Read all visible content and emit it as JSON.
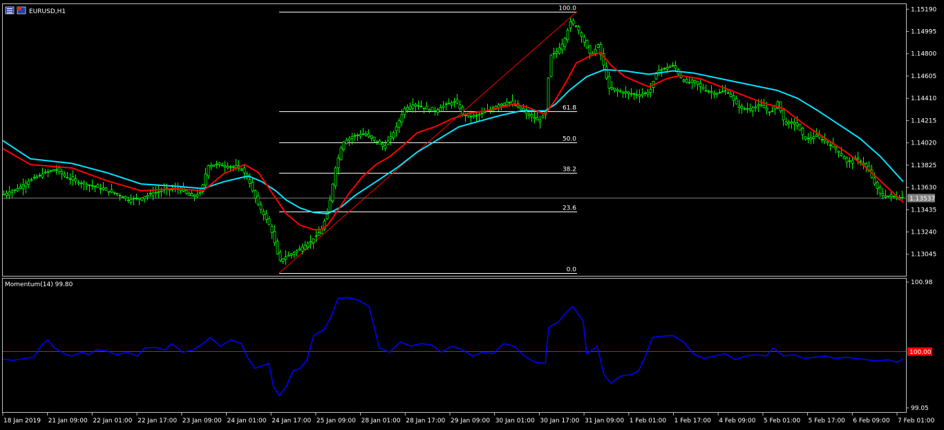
{
  "window": {
    "symbol_label": "EURUSD,H1",
    "indicator_label": "Momentum(14) 99.80"
  },
  "colors": {
    "background": "#000000",
    "frame": "#c0c0c0",
    "bull_candle": "#00ff00",
    "fast_ma": "#ff0000",
    "slow_ma": "#00e5ff",
    "fib": "#ffffff",
    "trendline": "#ff0000",
    "momentum": "#0000ff",
    "momentum_level": "#ff0000",
    "price_tag": "#808080",
    "level_tag": "#ff0000"
  },
  "chart_data": [
    {
      "type": "candlestick",
      "title": "EURUSD,H1",
      "y_ticks": [
        "1.15190",
        "1.14995",
        "1.14800",
        "1.14605",
        "1.14410",
        "1.14215",
        "1.14020",
        "1.13825",
        "1.13630",
        "1.13435",
        "1.13240",
        "1.13045"
      ],
      "ylim": [
        1.1288,
        1.1521
      ],
      "current_price": "1.13537",
      "x_ticks": [
        "18 Jan 2019",
        "21 Jan 09:00",
        "22 Jan 01:00",
        "22 Jan 17:00",
        "23 Jan 09:00",
        "24 Jan 01:00",
        "24 Jan 17:00",
        "25 Jan 09:00",
        "28 Jan 01:00",
        "28 Jan 17:00",
        "29 Jan 09:00",
        "30 Jan 01:00",
        "30 Jan 17:00",
        "31 Jan 09:00",
        "1 Feb 01:00",
        "1 Feb 17:00",
        "4 Feb 09:00",
        "5 Feb 01:00",
        "5 Feb 17:00",
        "6 Feb 09:00",
        "7 Feb 01:00"
      ],
      "close_path": [
        [
          0,
          1.1357
        ],
        [
          20,
          1.1362
        ],
        [
          40,
          1.137
        ],
        [
          60,
          1.1376
        ],
        [
          75,
          1.1379
        ],
        [
          90,
          1.1372
        ],
        [
          110,
          1.1367
        ],
        [
          130,
          1.1364
        ],
        [
          150,
          1.136
        ],
        [
          165,
          1.1357
        ],
        [
          180,
          1.1352
        ],
        [
          200,
          1.1354
        ],
        [
          215,
          1.1358
        ],
        [
          235,
          1.1361
        ],
        [
          255,
          1.1362
        ],
        [
          270,
          1.1355
        ],
        [
          285,
          1.1358
        ],
        [
          295,
          1.1382
        ],
        [
          310,
          1.1383
        ],
        [
          330,
          1.1381
        ],
        [
          345,
          1.1379
        ],
        [
          355,
          1.1368
        ],
        [
          365,
          1.1352
        ],
        [
          375,
          1.134
        ],
        [
          383,
          1.1332
        ],
        [
          390,
          1.132
        ],
        [
          395,
          1.1306
        ],
        [
          400,
          1.1299
        ],
        [
          410,
          1.1303
        ],
        [
          420,
          1.1306
        ],
        [
          430,
          1.131
        ],
        [
          445,
          1.1316
        ],
        [
          460,
          1.1326
        ],
        [
          470,
          1.1345
        ],
        [
          480,
          1.138
        ],
        [
          490,
          1.1402
        ],
        [
          505,
          1.1408
        ],
        [
          520,
          1.141
        ],
        [
          535,
          1.1405
        ],
        [
          550,
          1.1398
        ],
        [
          565,
          1.1412
        ],
        [
          580,
          1.1432
        ],
        [
          595,
          1.1436
        ],
        [
          610,
          1.1432
        ],
        [
          625,
          1.143
        ],
        [
          640,
          1.1436
        ],
        [
          655,
          1.1438
        ],
        [
          665,
          1.1426
        ],
        [
          680,
          1.1425
        ],
        [
          700,
          1.143
        ],
        [
          715,
          1.1435
        ],
        [
          730,
          1.1438
        ],
        [
          745,
          1.1433
        ],
        [
          760,
          1.1426
        ],
        [
          775,
          1.1421
        ],
        [
          785,
          1.143
        ],
        [
          790,
          1.1478
        ],
        [
          800,
          1.1482
        ],
        [
          810,
          1.149
        ],
        [
          820,
          1.1508
        ],
        [
          830,
          1.1503
        ],
        [
          840,
          1.149
        ],
        [
          850,
          1.1478
        ],
        [
          860,
          1.1488
        ],
        [
          868,
          1.147
        ],
        [
          875,
          1.145
        ],
        [
          890,
          1.1447
        ],
        [
          905,
          1.1445
        ],
        [
          920,
          1.1444
        ],
        [
          935,
          1.1447
        ],
        [
          945,
          1.1465
        ],
        [
          960,
          1.1468
        ],
        [
          970,
          1.147
        ],
        [
          975,
          1.1463
        ],
        [
          985,
          1.1455
        ],
        [
          1000,
          1.1455
        ],
        [
          1015,
          1.1448
        ],
        [
          1030,
          1.1445
        ],
        [
          1045,
          1.1448
        ],
        [
          1055,
          1.144
        ],
        [
          1065,
          1.1432
        ],
        [
          1080,
          1.1432
        ],
        [
          1095,
          1.1435
        ],
        [
          1110,
          1.1428
        ],
        [
          1120,
          1.1438
        ],
        [
          1130,
          1.1418
        ],
        [
          1145,
          1.142
        ],
        [
          1160,
          1.1405
        ],
        [
          1175,
          1.1408
        ],
        [
          1190,
          1.1403
        ],
        [
          1205,
          1.1396
        ],
        [
          1220,
          1.1385
        ],
        [
          1235,
          1.1388
        ],
        [
          1250,
          1.138
        ],
        [
          1260,
          1.1366
        ],
        [
          1270,
          1.1356
        ],
        [
          1285,
          1.1355
        ],
        [
          1300,
          1.1354
        ]
      ],
      "fast_ma": [
        [
          0,
          1.1397
        ],
        [
          40,
          1.1383
        ],
        [
          100,
          1.138
        ],
        [
          150,
          1.1369
        ],
        [
          200,
          1.136
        ],
        [
          250,
          1.1362
        ],
        [
          290,
          1.136
        ],
        [
          320,
          1.1375
        ],
        [
          350,
          1.1383
        ],
        [
          370,
          1.1376
        ],
        [
          390,
          1.1358
        ],
        [
          410,
          1.134
        ],
        [
          430,
          1.133
        ],
        [
          450,
          1.1326
        ],
        [
          460,
          1.1326
        ],
        [
          470,
          1.133
        ],
        [
          485,
          1.1343
        ],
        [
          500,
          1.1357
        ],
        [
          520,
          1.1372
        ],
        [
          540,
          1.1383
        ],
        [
          560,
          1.139
        ],
        [
          580,
          1.14
        ],
        [
          600,
          1.1411
        ],
        [
          625,
          1.1416
        ],
        [
          650,
          1.1423
        ],
        [
          675,
          1.1428
        ],
        [
          700,
          1.143
        ],
        [
          740,
          1.1436
        ],
        [
          760,
          1.1433
        ],
        [
          785,
          1.1427
        ],
        [
          800,
          1.144
        ],
        [
          815,
          1.1455
        ],
        [
          830,
          1.1472
        ],
        [
          850,
          1.1478
        ],
        [
          865,
          1.1481
        ],
        [
          880,
          1.147
        ],
        [
          900,
          1.146
        ],
        [
          935,
          1.1451
        ],
        [
          960,
          1.1458
        ],
        [
          980,
          1.1461
        ],
        [
          1010,
          1.1458
        ],
        [
          1040,
          1.1451
        ],
        [
          1070,
          1.1444
        ],
        [
          1100,
          1.1437
        ],
        [
          1130,
          1.1432
        ],
        [
          1160,
          1.1418
        ],
        [
          1190,
          1.1406
        ],
        [
          1220,
          1.1394
        ],
        [
          1250,
          1.138
        ],
        [
          1280,
          1.1363
        ],
        [
          1303,
          1.135
        ]
      ],
      "slow_ma": [
        [
          0,
          1.1404
        ],
        [
          40,
          1.1388
        ],
        [
          100,
          1.1384
        ],
        [
          150,
          1.1376
        ],
        [
          200,
          1.1366
        ],
        [
          250,
          1.1364
        ],
        [
          290,
          1.1362
        ],
        [
          320,
          1.1368
        ],
        [
          355,
          1.1373
        ],
        [
          375,
          1.1368
        ],
        [
          395,
          1.136
        ],
        [
          410,
          1.1352
        ],
        [
          430,
          1.1345
        ],
        [
          450,
          1.1341
        ],
        [
          470,
          1.134
        ],
        [
          490,
          1.1346
        ],
        [
          510,
          1.1356
        ],
        [
          540,
          1.1368
        ],
        [
          570,
          1.138
        ],
        [
          600,
          1.1394
        ],
        [
          630,
          1.1405
        ],
        [
          660,
          1.1416
        ],
        [
          690,
          1.1421
        ],
        [
          720,
          1.1426
        ],
        [
          750,
          1.143
        ],
        [
          785,
          1.143
        ],
        [
          800,
          1.1436
        ],
        [
          820,
          1.1448
        ],
        [
          845,
          1.146
        ],
        [
          870,
          1.1466
        ],
        [
          900,
          1.1465
        ],
        [
          935,
          1.1462
        ],
        [
          970,
          1.1465
        ],
        [
          1000,
          1.1463
        ],
        [
          1040,
          1.1458
        ],
        [
          1080,
          1.1453
        ],
        [
          1120,
          1.1448
        ],
        [
          1150,
          1.1441
        ],
        [
          1180,
          1.143
        ],
        [
          1210,
          1.1418
        ],
        [
          1240,
          1.1406
        ],
        [
          1270,
          1.139
        ],
        [
          1303,
          1.1368
        ]
      ],
      "fibonacci": {
        "levels": [
          "100.0",
          "61.8",
          "50.0",
          "38.2",
          "23.6",
          "0.0"
        ],
        "ratios": [
          1.0,
          0.618,
          0.5,
          0.382,
          0.236,
          0.0
        ],
        "low": 1.1288,
        "high": 1.1517
      }
    },
    {
      "type": "line",
      "title": "Momentum(14) 99.80",
      "y_ticks": [
        "100.98",
        "100.00",
        "99.05"
      ],
      "ylim": [
        99.05,
        100.98
      ],
      "level": 100.0,
      "values": [
        [
          0,
          99.87
        ],
        [
          15,
          99.85
        ],
        [
          30,
          99.88
        ],
        [
          45,
          99.9
        ],
        [
          55,
          100.08
        ],
        [
          65,
          100.18
        ],
        [
          75,
          100.05
        ],
        [
          90,
          99.95
        ],
        [
          100,
          99.92
        ],
        [
          115,
          99.98
        ],
        [
          125,
          99.94
        ],
        [
          135,
          100.02
        ],
        [
          150,
          100.0
        ],
        [
          165,
          99.94
        ],
        [
          180,
          99.98
        ],
        [
          195,
          99.92
        ],
        [
          205,
          100.05
        ],
        [
          220,
          100.06
        ],
        [
          235,
          100.02
        ],
        [
          245,
          100.12
        ],
        [
          260,
          99.98
        ],
        [
          275,
          100.02
        ],
        [
          290,
          100.12
        ],
        [
          300,
          100.22
        ],
        [
          315,
          100.08
        ],
        [
          330,
          100.18
        ],
        [
          345,
          100.12
        ],
        [
          355,
          99.88
        ],
        [
          365,
          99.72
        ],
        [
          375,
          99.76
        ],
        [
          385,
          99.8
        ],
        [
          392,
          99.42
        ],
        [
          400,
          99.28
        ],
        [
          410,
          99.42
        ],
        [
          420,
          99.68
        ],
        [
          430,
          99.72
        ],
        [
          440,
          99.85
        ],
        [
          450,
          100.25
        ],
        [
          465,
          100.35
        ],
        [
          475,
          100.55
        ],
        [
          485,
          100.85
        ],
        [
          500,
          100.86
        ],
        [
          515,
          100.82
        ],
        [
          530,
          100.72
        ],
        [
          545,
          100.05
        ],
        [
          560,
          99.98
        ],
        [
          575,
          100.15
        ],
        [
          590,
          100.08
        ],
        [
          605,
          100.12
        ],
        [
          620,
          100.1
        ],
        [
          635,
          99.98
        ],
        [
          650,
          100.08
        ],
        [
          665,
          100.02
        ],
        [
          680,
          99.92
        ],
        [
          695,
          99.98
        ],
        [
          710,
          99.96
        ],
        [
          725,
          100.12
        ],
        [
          740,
          100.08
        ],
        [
          755,
          99.92
        ],
        [
          770,
          99.82
        ],
        [
          785,
          99.8
        ],
        [
          790,
          100.38
        ],
        [
          805,
          100.48
        ],
        [
          815,
          100.62
        ],
        [
          825,
          100.72
        ],
        [
          840,
          100.48
        ],
        [
          845,
          99.95
        ],
        [
          860,
          100.08
        ],
        [
          870,
          99.62
        ],
        [
          880,
          99.48
        ],
        [
          895,
          99.6
        ],
        [
          910,
          99.62
        ],
        [
          920,
          99.68
        ],
        [
          930,
          99.92
        ],
        [
          940,
          100.22
        ],
        [
          955,
          100.24
        ],
        [
          970,
          100.25
        ],
        [
          985,
          100.15
        ],
        [
          1000,
          99.95
        ],
        [
          1015,
          99.88
        ],
        [
          1030,
          99.92
        ],
        [
          1045,
          99.96
        ],
        [
          1060,
          99.86
        ],
        [
          1075,
          99.92
        ],
        [
          1090,
          99.94
        ],
        [
          1105,
          99.92
        ],
        [
          1115,
          100.05
        ],
        [
          1130,
          99.92
        ],
        [
          1145,
          99.94
        ],
        [
          1160,
          99.88
        ],
        [
          1175,
          99.9
        ],
        [
          1190,
          99.92
        ],
        [
          1205,
          99.88
        ],
        [
          1220,
          99.9
        ],
        [
          1235,
          99.88
        ],
        [
          1250,
          99.86
        ],
        [
          1265,
          99.84
        ],
        [
          1280,
          99.86
        ],
        [
          1295,
          99.82
        ],
        [
          1303,
          99.88
        ]
      ]
    }
  ]
}
